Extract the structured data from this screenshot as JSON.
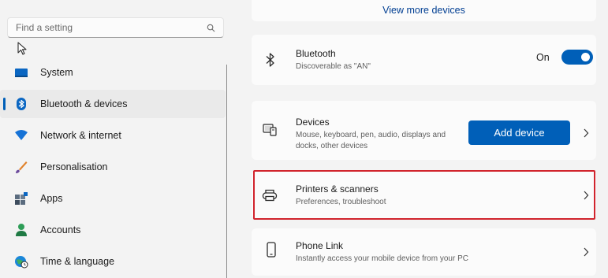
{
  "search": {
    "placeholder": "Find a setting"
  },
  "sidebar": {
    "items": [
      {
        "label": "System",
        "icon": "monitor-icon",
        "active": false
      },
      {
        "label": "Bluetooth & devices",
        "icon": "bluetooth-icon",
        "active": true
      },
      {
        "label": "Network & internet",
        "icon": "wifi-icon",
        "active": false
      },
      {
        "label": "Personalisation",
        "icon": "brush-icon",
        "active": false
      },
      {
        "label": "Apps",
        "icon": "apps-icon",
        "active": false
      },
      {
        "label": "Accounts",
        "icon": "person-icon",
        "active": false
      },
      {
        "label": "Time & language",
        "icon": "globe-clock-icon",
        "active": false
      }
    ]
  },
  "main": {
    "view_more": "View more devices",
    "bluetooth": {
      "title": "Bluetooth",
      "subtitle": "Discoverable as \"AN\"",
      "state_label": "On",
      "enabled": true
    },
    "devices": {
      "title": "Devices",
      "subtitle": "Mouse, keyboard, pen, audio, displays and docks, other devices",
      "button_label": "Add device"
    },
    "printers": {
      "title": "Printers & scanners",
      "subtitle": "Preferences, troubleshoot",
      "highlighted": true
    },
    "phone_link": {
      "title": "Phone Link",
      "subtitle": "Instantly access your mobile device from your PC"
    }
  },
  "colors": {
    "accent": "#005fb8",
    "highlight_border": "#d1242d",
    "background": "#f3f3f3",
    "card": "#fbfbfb"
  }
}
